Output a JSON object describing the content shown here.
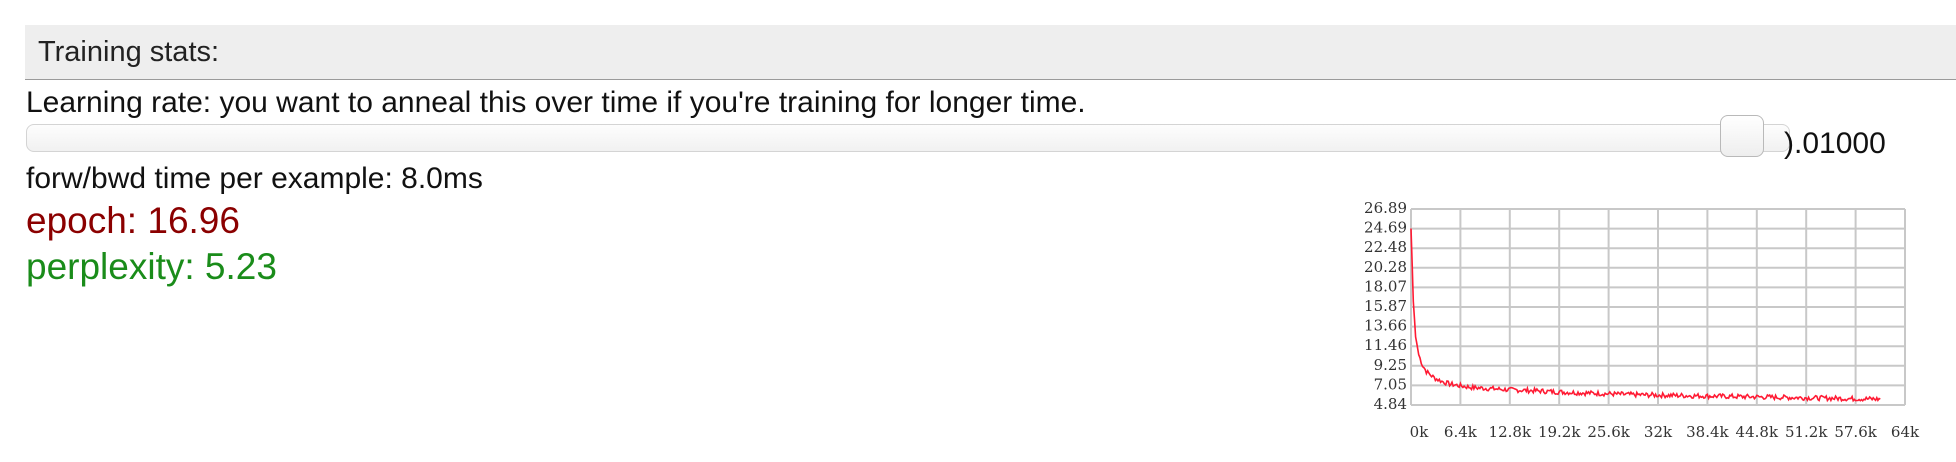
{
  "header": {
    "title": "Training stats:"
  },
  "learning_rate": {
    "description": "Learning rate: you want to anneal this over time if you're training for longer time.",
    "value": 0.01,
    "value_label": ").01000",
    "slider_level": 0.985
  },
  "timing": {
    "text": "forw/bwd time per example: 8.0ms"
  },
  "stats": {
    "epoch_text": "epoch: 16.96",
    "perplexity_text": "perplexity: 5.23"
  },
  "colors": {
    "epoch": "#8b0000",
    "perplexity": "#1a8c1a",
    "series": "#ff1a33"
  },
  "chart_data": {
    "type": "line",
    "title": "",
    "xlabel": "",
    "ylabel": "",
    "grid": true,
    "xlim": [
      0,
      64000
    ],
    "ylim": [
      4.84,
      26.89
    ],
    "x_ticks": [
      "0k",
      "6.4k",
      "12.8k",
      "19.2k",
      "25.6k",
      "32k",
      "38.4k",
      "44.8k",
      "51.2k",
      "57.6k",
      "64k"
    ],
    "y_ticks": [
      "26.89",
      "24.69",
      "22.48",
      "20.28",
      "18.07",
      "15.87",
      "13.66",
      "11.46",
      "9.25",
      "7.05",
      "4.84"
    ],
    "series": [
      {
        "x": [
          0,
          300,
          600,
          1000,
          1500,
          2000,
          3000,
          4000,
          5000,
          6400,
          8000,
          10000,
          12800,
          16000,
          19200,
          22400,
          25600,
          28800,
          32000,
          35200,
          38400,
          41600,
          44800,
          48000,
          51200,
          54400,
          57600,
          60800
        ],
        "values": [
          24.7,
          16.5,
          12.5,
          10.5,
          9.3,
          8.6,
          7.9,
          7.5,
          7.2,
          7.0,
          6.8,
          6.7,
          6.55,
          6.45,
          6.3,
          6.2,
          6.1,
          6.0,
          5.95,
          5.9,
          5.85,
          5.8,
          5.75,
          5.7,
          5.65,
          5.6,
          5.55,
          5.5
        ]
      }
    ]
  }
}
